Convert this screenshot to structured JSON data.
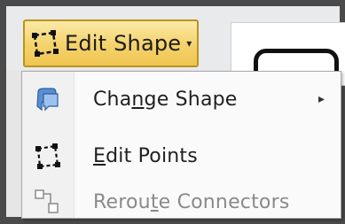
{
  "ribbon": {
    "edit_shape": {
      "label": "Edit Shape",
      "icon": "edit-shape-icon",
      "caret": "▾"
    }
  },
  "menu": {
    "items": [
      {
        "pre": "Cha",
        "acc": "n",
        "post": "ge Shape",
        "icon": "change-shape-icon",
        "submenu": "▸",
        "enabled": true
      },
      {
        "pre": "",
        "acc": "E",
        "post": "dit Points",
        "icon": "edit-points-icon",
        "enabled": true
      },
      {
        "pre": "Rerou",
        "acc": "t",
        "post": "e Connectors",
        "icon": "reroute-connectors-icon",
        "enabled": false
      }
    ]
  },
  "colors": {
    "button_fill": "#f4d26a",
    "button_border": "#b8951e",
    "disabled_text": "#8a8a8a"
  }
}
